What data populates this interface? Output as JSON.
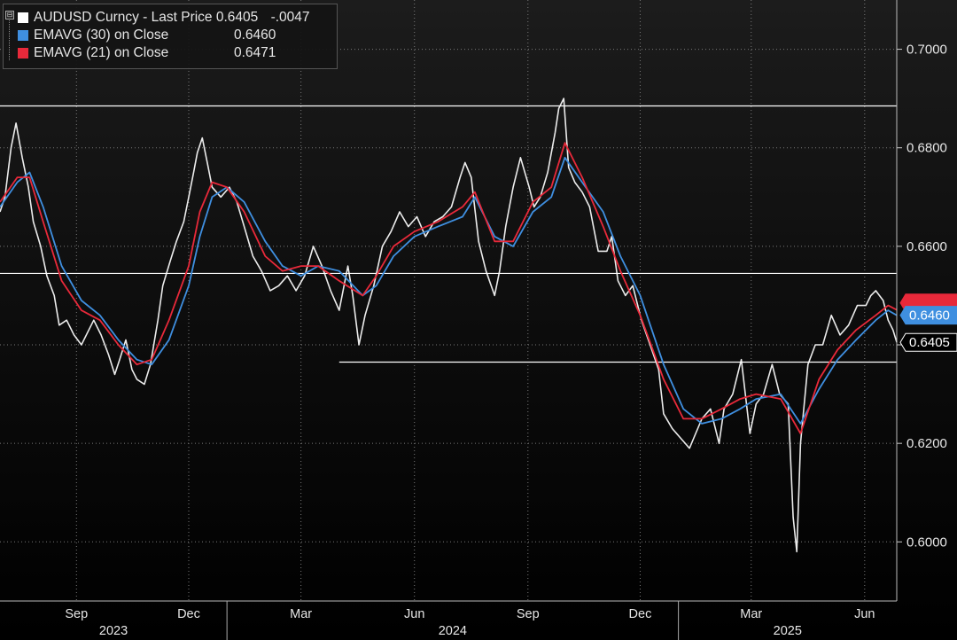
{
  "legend": {
    "tree_glyph": "⊟",
    "last_label": "AUDUSD Curncy - Last Price",
    "last_value": "0.6405",
    "last_change": "-.0047",
    "ema30_label": "EMAVG (30)  on Close",
    "ema30_value": "0.6460",
    "ema21_label": "EMAVG (21)  on Close",
    "ema21_value": "0.6471"
  },
  "colors": {
    "price": "#ffffff",
    "ema30": "#3f8fe0",
    "ema21": "#e8293a",
    "grid": "#7a7a7a",
    "level": "#ffffff"
  },
  "chart_data": {
    "type": "line",
    "ylim": [
      0.588,
      0.71
    ],
    "yticks": [
      "0.6000",
      "0.6200",
      "0.6400",
      "0.6600",
      "0.6800",
      "0.7000"
    ],
    "x_start": "2023-07-01",
    "x_end": "2025-06-27",
    "x_ticks": [
      {
        "label": "Sep",
        "date": "2023-09-01"
      },
      {
        "label": "Dec",
        "date": "2023-12-01"
      },
      {
        "label": "Mar",
        "date": "2024-03-01"
      },
      {
        "label": "Jun",
        "date": "2024-06-01"
      },
      {
        "label": "Sep",
        "date": "2024-09-01"
      },
      {
        "label": "Dec",
        "date": "2024-12-01"
      },
      {
        "label": "Mar",
        "date": "2025-03-01"
      },
      {
        "label": "Jun",
        "date": "2025-06-01"
      }
    ],
    "years": [
      {
        "label": "2023",
        "start": "2023-07-01",
        "end": "2024-01-01"
      },
      {
        "label": "2024",
        "start": "2024-01-01",
        "end": "2025-01-01"
      },
      {
        "label": "2025",
        "start": "2025-01-01",
        "end": "2025-06-27"
      }
    ],
    "levels": [
      {
        "y": 0.6885,
        "from": "2023-07-01",
        "to": "2025-06-27"
      },
      {
        "y": 0.6545,
        "from": "2023-07-01",
        "to": "2025-06-27"
      },
      {
        "y": 0.6365,
        "from": "2024-04-01",
        "to": "2025-06-27"
      }
    ],
    "series": [
      {
        "key": "price",
        "points": [
          [
            "2023-07-01",
            0.667
          ],
          [
            "2023-07-05",
            0.67
          ],
          [
            "2023-07-10",
            0.68
          ],
          [
            "2023-07-14",
            0.685
          ],
          [
            "2023-07-19",
            0.678
          ],
          [
            "2023-07-24",
            0.672
          ],
          [
            "2023-07-28",
            0.665
          ],
          [
            "2023-08-03",
            0.66
          ],
          [
            "2023-08-08",
            0.654
          ],
          [
            "2023-08-14",
            0.65
          ],
          [
            "2023-08-18",
            0.644
          ],
          [
            "2023-08-24",
            0.645
          ],
          [
            "2023-08-30",
            0.642
          ],
          [
            "2023-09-05",
            0.64
          ],
          [
            "2023-09-11",
            0.643
          ],
          [
            "2023-09-15",
            0.645
          ],
          [
            "2023-09-21",
            0.642
          ],
          [
            "2023-09-27",
            0.638
          ],
          [
            "2023-10-02",
            0.634
          ],
          [
            "2023-10-06",
            0.637
          ],
          [
            "2023-10-11",
            0.641
          ],
          [
            "2023-10-16",
            0.635
          ],
          [
            "2023-10-20",
            0.633
          ],
          [
            "2023-10-26",
            0.632
          ],
          [
            "2023-10-31",
            0.636
          ],
          [
            "2023-11-06",
            0.645
          ],
          [
            "2023-11-10",
            0.652
          ],
          [
            "2023-11-16",
            0.657
          ],
          [
            "2023-11-21",
            0.661
          ],
          [
            "2023-11-27",
            0.665
          ],
          [
            "2023-12-01",
            0.67
          ],
          [
            "2023-12-05",
            0.675
          ],
          [
            "2023-12-08",
            0.679
          ],
          [
            "2023-12-12",
            0.682
          ],
          [
            "2023-12-16",
            0.677
          ],
          [
            "2023-12-20",
            0.672
          ],
          [
            "2023-12-27",
            0.67
          ],
          [
            "2024-01-03",
            0.672
          ],
          [
            "2024-01-09",
            0.669
          ],
          [
            "2024-01-15",
            0.664
          ],
          [
            "2024-01-22",
            0.658
          ],
          [
            "2024-01-29",
            0.655
          ],
          [
            "2024-02-05",
            0.651
          ],
          [
            "2024-02-12",
            0.652
          ],
          [
            "2024-02-19",
            0.654
          ],
          [
            "2024-02-26",
            0.651
          ],
          [
            "2024-03-04",
            0.654
          ],
          [
            "2024-03-11",
            0.66
          ],
          [
            "2024-03-18",
            0.656
          ],
          [
            "2024-03-25",
            0.651
          ],
          [
            "2024-04-01",
            0.647
          ],
          [
            "2024-04-08",
            0.656
          ],
          [
            "2024-04-12",
            0.65
          ],
          [
            "2024-04-17",
            0.64
          ],
          [
            "2024-04-22",
            0.646
          ],
          [
            "2024-04-29",
            0.652
          ],
          [
            "2024-05-06",
            0.66
          ],
          [
            "2024-05-13",
            0.663
          ],
          [
            "2024-05-20",
            0.667
          ],
          [
            "2024-05-27",
            0.664
          ],
          [
            "2024-06-03",
            0.666
          ],
          [
            "2024-06-10",
            0.662
          ],
          [
            "2024-06-17",
            0.665
          ],
          [
            "2024-06-24",
            0.666
          ],
          [
            "2024-07-01",
            0.668
          ],
          [
            "2024-07-08",
            0.674
          ],
          [
            "2024-07-12",
            0.677
          ],
          [
            "2024-07-17",
            0.674
          ],
          [
            "2024-07-23",
            0.661
          ],
          [
            "2024-07-29",
            0.655
          ],
          [
            "2024-08-05",
            0.65
          ],
          [
            "2024-08-09",
            0.655
          ],
          [
            "2024-08-14",
            0.664
          ],
          [
            "2024-08-20",
            0.672
          ],
          [
            "2024-08-26",
            0.678
          ],
          [
            "2024-09-02",
            0.672
          ],
          [
            "2024-09-06",
            0.668
          ],
          [
            "2024-09-11",
            0.67
          ],
          [
            "2024-09-17",
            0.675
          ],
          [
            "2024-09-23",
            0.683
          ],
          [
            "2024-09-26",
            0.688
          ],
          [
            "2024-09-30",
            0.69
          ],
          [
            "2024-10-04",
            0.676
          ],
          [
            "2024-10-09",
            0.673
          ],
          [
            "2024-10-15",
            0.671
          ],
          [
            "2024-10-21",
            0.668
          ],
          [
            "2024-10-28",
            0.659
          ],
          [
            "2024-11-04",
            0.659
          ],
          [
            "2024-11-08",
            0.662
          ],
          [
            "2024-11-13",
            0.653
          ],
          [
            "2024-11-19",
            0.65
          ],
          [
            "2024-11-25",
            0.652
          ],
          [
            "2024-12-02",
            0.645
          ],
          [
            "2024-12-09",
            0.64
          ],
          [
            "2024-12-16",
            0.635
          ],
          [
            "2024-12-20",
            0.626
          ],
          [
            "2024-12-27",
            0.623
          ],
          [
            "2025-01-03",
            0.621
          ],
          [
            "2025-01-10",
            0.619
          ],
          [
            "2025-01-15",
            0.622
          ],
          [
            "2025-01-20",
            0.625
          ],
          [
            "2025-01-27",
            0.627
          ],
          [
            "2025-02-03",
            0.62
          ],
          [
            "2025-02-07",
            0.627
          ],
          [
            "2025-02-14",
            0.63
          ],
          [
            "2025-02-21",
            0.637
          ],
          [
            "2025-02-28",
            0.622
          ],
          [
            "2025-03-05",
            0.628
          ],
          [
            "2025-03-11",
            0.63
          ],
          [
            "2025-03-18",
            0.636
          ],
          [
            "2025-03-24",
            0.63
          ],
          [
            "2025-03-31",
            0.628
          ],
          [
            "2025-04-04",
            0.605
          ],
          [
            "2025-04-07",
            0.598
          ],
          [
            "2025-04-10",
            0.62
          ],
          [
            "2025-04-16",
            0.636
          ],
          [
            "2025-04-22",
            0.64
          ],
          [
            "2025-04-28",
            0.64
          ],
          [
            "2025-05-05",
            0.646
          ],
          [
            "2025-05-12",
            0.642
          ],
          [
            "2025-05-19",
            0.644
          ],
          [
            "2025-05-26",
            0.648
          ],
          [
            "2025-06-02",
            0.648
          ],
          [
            "2025-06-06",
            0.65
          ],
          [
            "2025-06-10",
            0.651
          ],
          [
            "2025-06-16",
            0.649
          ],
          [
            "2025-06-20",
            0.645
          ],
          [
            "2025-06-24",
            0.643
          ],
          [
            "2025-06-27",
            0.6405
          ]
        ]
      },
      {
        "key": "ema30",
        "name": "EMAVG (30)  on Close",
        "points": [
          [
            "2023-07-01",
            0.668
          ],
          [
            "2023-07-15",
            0.673
          ],
          [
            "2023-07-25",
            0.675
          ],
          [
            "2023-08-05",
            0.668
          ],
          [
            "2023-08-20",
            0.656
          ],
          [
            "2023-09-05",
            0.649
          ],
          [
            "2023-09-20",
            0.646
          ],
          [
            "2023-10-05",
            0.641
          ],
          [
            "2023-10-20",
            0.637
          ],
          [
            "2023-11-01",
            0.636
          ],
          [
            "2023-11-15",
            0.641
          ],
          [
            "2023-12-01",
            0.652
          ],
          [
            "2023-12-10",
            0.662
          ],
          [
            "2023-12-20",
            0.67
          ],
          [
            "2024-01-01",
            0.672
          ],
          [
            "2024-01-15",
            0.669
          ],
          [
            "2024-02-01",
            0.661
          ],
          [
            "2024-02-15",
            0.656
          ],
          [
            "2024-03-01",
            0.654
          ],
          [
            "2024-03-15",
            0.656
          ],
          [
            "2024-04-01",
            0.655
          ],
          [
            "2024-04-20",
            0.65
          ],
          [
            "2024-05-01",
            0.652
          ],
          [
            "2024-05-15",
            0.658
          ],
          [
            "2024-06-01",
            0.662
          ],
          [
            "2024-06-20",
            0.664
          ],
          [
            "2024-07-10",
            0.666
          ],
          [
            "2024-07-20",
            0.67
          ],
          [
            "2024-08-05",
            0.662
          ],
          [
            "2024-08-20",
            0.66
          ],
          [
            "2024-09-05",
            0.667
          ],
          [
            "2024-09-20",
            0.67
          ],
          [
            "2024-10-01",
            0.678
          ],
          [
            "2024-10-15",
            0.673
          ],
          [
            "2024-11-01",
            0.667
          ],
          [
            "2024-11-15",
            0.658
          ],
          [
            "2024-12-01",
            0.65
          ],
          [
            "2024-12-20",
            0.636
          ],
          [
            "2025-01-05",
            0.627
          ],
          [
            "2025-01-20",
            0.624
          ],
          [
            "2025-02-05",
            0.625
          ],
          [
            "2025-02-20",
            0.627
          ],
          [
            "2025-03-05",
            0.629
          ],
          [
            "2025-03-25",
            0.63
          ],
          [
            "2025-04-10",
            0.624
          ],
          [
            "2025-04-25",
            0.631
          ],
          [
            "2025-05-10",
            0.637
          ],
          [
            "2025-05-25",
            0.641
          ],
          [
            "2025-06-10",
            0.645
          ],
          [
            "2025-06-20",
            0.647
          ],
          [
            "2025-06-27",
            0.646
          ]
        ]
      },
      {
        "key": "ema21",
        "name": "EMAVG (21)  on Close",
        "points": [
          [
            "2023-07-01",
            0.669
          ],
          [
            "2023-07-15",
            0.674
          ],
          [
            "2023-07-25",
            0.674
          ],
          [
            "2023-08-05",
            0.665
          ],
          [
            "2023-08-20",
            0.653
          ],
          [
            "2023-09-05",
            0.647
          ],
          [
            "2023-09-20",
            0.645
          ],
          [
            "2023-10-05",
            0.64
          ],
          [
            "2023-10-20",
            0.636
          ],
          [
            "2023-11-01",
            0.637
          ],
          [
            "2023-11-15",
            0.645
          ],
          [
            "2023-12-01",
            0.656
          ],
          [
            "2023-12-10",
            0.667
          ],
          [
            "2023-12-20",
            0.673
          ],
          [
            "2024-01-01",
            0.672
          ],
          [
            "2024-01-15",
            0.667
          ],
          [
            "2024-02-01",
            0.658
          ],
          [
            "2024-02-15",
            0.655
          ],
          [
            "2024-03-01",
            0.656
          ],
          [
            "2024-03-15",
            0.656
          ],
          [
            "2024-04-01",
            0.653
          ],
          [
            "2024-04-20",
            0.65
          ],
          [
            "2024-05-01",
            0.654
          ],
          [
            "2024-05-15",
            0.66
          ],
          [
            "2024-06-01",
            0.663
          ],
          [
            "2024-06-20",
            0.665
          ],
          [
            "2024-07-10",
            0.668
          ],
          [
            "2024-07-20",
            0.671
          ],
          [
            "2024-08-05",
            0.661
          ],
          [
            "2024-08-20",
            0.661
          ],
          [
            "2024-09-05",
            0.669
          ],
          [
            "2024-09-20",
            0.672
          ],
          [
            "2024-10-01",
            0.681
          ],
          [
            "2024-10-15",
            0.674
          ],
          [
            "2024-11-01",
            0.664
          ],
          [
            "2024-11-15",
            0.655
          ],
          [
            "2024-12-01",
            0.646
          ],
          [
            "2024-12-20",
            0.633
          ],
          [
            "2025-01-05",
            0.625
          ],
          [
            "2025-01-20",
            0.625
          ],
          [
            "2025-02-05",
            0.627
          ],
          [
            "2025-02-20",
            0.629
          ],
          [
            "2025-03-05",
            0.63
          ],
          [
            "2025-03-25",
            0.629
          ],
          [
            "2025-04-10",
            0.622
          ],
          [
            "2025-04-25",
            0.633
          ],
          [
            "2025-05-10",
            0.639
          ],
          [
            "2025-05-25",
            0.643
          ],
          [
            "2025-06-10",
            0.646
          ],
          [
            "2025-06-20",
            0.648
          ],
          [
            "2025-06-27",
            0.6471
          ]
        ]
      }
    ],
    "tags": [
      {
        "key": "ema21",
        "y": 0.6485,
        "label": ""
      },
      {
        "key": "ema30",
        "y": 0.646,
        "label": "0.6460"
      },
      {
        "key": "price",
        "y": 0.6405,
        "label": "0.6405"
      }
    ]
  }
}
